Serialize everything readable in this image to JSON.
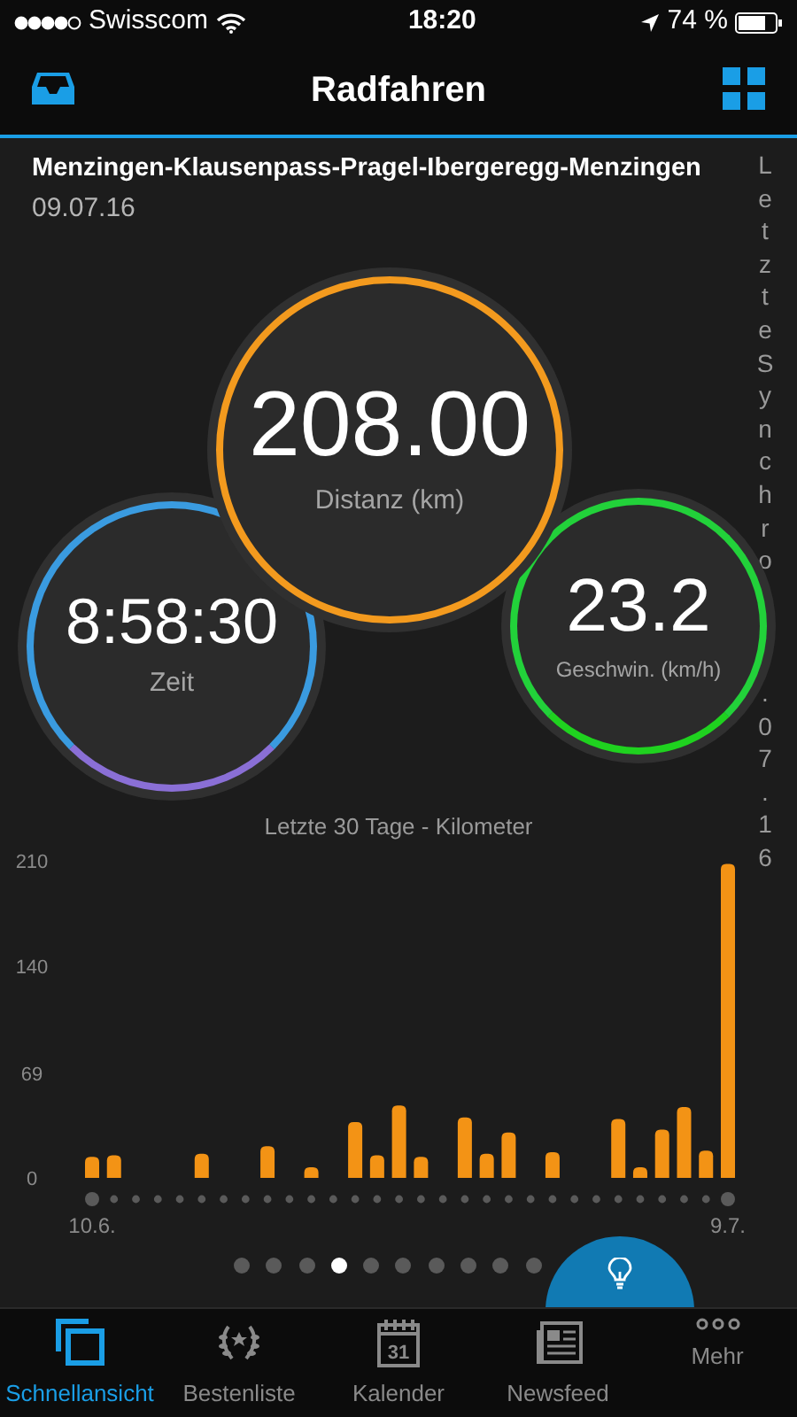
{
  "status_bar": {
    "carrier": "Swisscom",
    "time": "18:20",
    "battery": "74 %"
  },
  "nav": {
    "title": "Radfahren"
  },
  "activity": {
    "name": "Menzingen-Klausenpass-Pragel-Ibergeregg-Menzingen",
    "date": "09.07.16"
  },
  "side_note": {
    "top": "LetzteSynchro",
    "bottom": ".07.16"
  },
  "stats": [
    {
      "kind": "time",
      "value": "8:58:30",
      "label": "Zeit",
      "color": "#3a9be0"
    },
    {
      "kind": "distance",
      "value": "208.00",
      "label": "Distanz (km)",
      "color": "#f39a1e"
    },
    {
      "kind": "speed",
      "value": "23.2",
      "label": "Geschwin. (km/h)",
      "color": "#22d13a"
    }
  ],
  "chart_data": {
    "type": "bar",
    "title": "Letzte 30 Tage - Kilometer",
    "categories": [
      "10.6.",
      null,
      null,
      null,
      null,
      null,
      null,
      null,
      null,
      null,
      null,
      null,
      null,
      null,
      null,
      null,
      null,
      null,
      null,
      null,
      null,
      null,
      null,
      null,
      null,
      null,
      null,
      null,
      null,
      "9.7."
    ],
    "values": [
      14,
      15,
      0,
      0,
      0,
      16,
      0,
      0,
      21,
      0,
      7,
      0,
      37,
      15,
      48,
      14,
      0,
      40,
      16,
      30,
      0,
      17,
      0,
      0,
      39,
      7,
      32,
      47,
      18,
      208
    ],
    "ylim": [
      0,
      210
    ],
    "yticks": [
      0,
      69,
      140,
      210
    ]
  },
  "pager": [
    {
      "selected": false
    },
    {
      "selected": false
    },
    {
      "selected": false
    },
    {
      "selected": true
    },
    {
      "selected": false
    },
    {
      "selected": false
    },
    {
      "selected": false
    },
    {
      "selected": false
    },
    {
      "selected": false
    },
    {
      "selected": false
    }
  ],
  "tabs": [
    {
      "kind": "overview",
      "label": "Schnellansicht",
      "selected": true
    },
    {
      "kind": "leaderboard",
      "label": "Bestenliste",
      "selected": false
    },
    {
      "kind": "calendar",
      "label": "Kalender",
      "icon_text": "31",
      "selected": false
    },
    {
      "kind": "newsfeed",
      "label": "Newsfeed",
      "selected": false
    },
    {
      "kind": "more",
      "label": "Mehr",
      "selected": false
    }
  ]
}
